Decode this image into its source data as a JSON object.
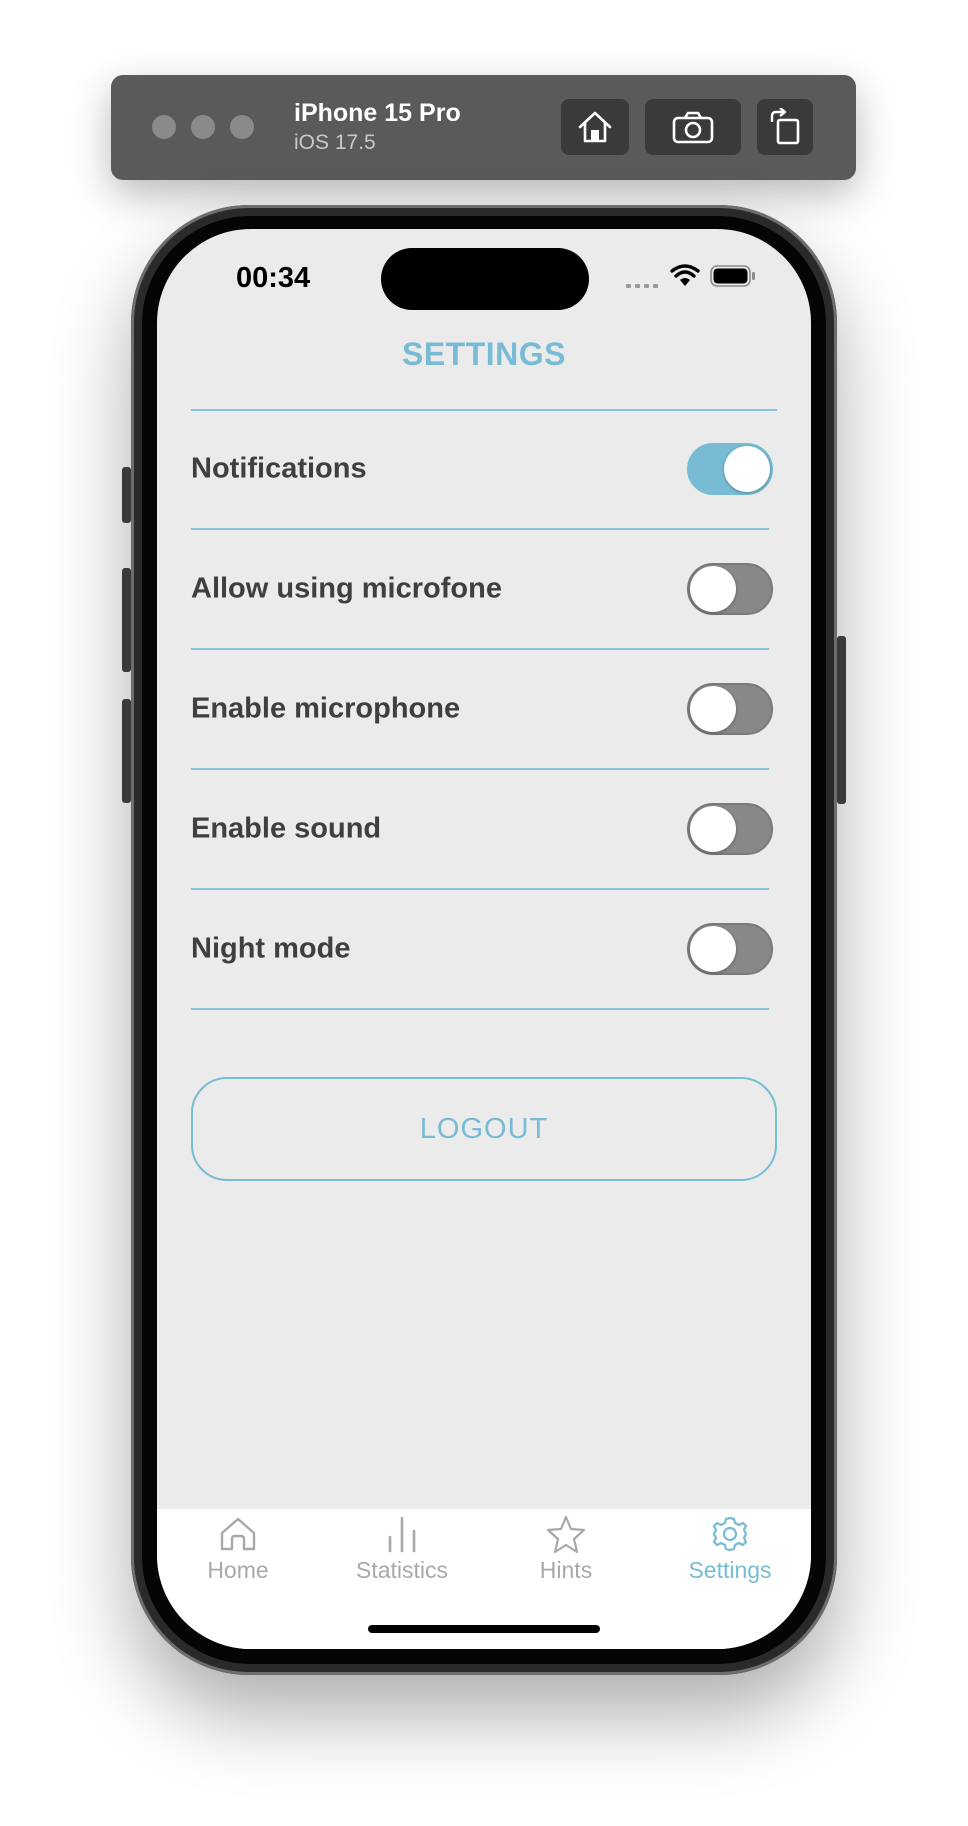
{
  "simulator": {
    "device_name": "iPhone 15 Pro",
    "os_version": "iOS 17.5",
    "buttons": [
      "home-icon",
      "screenshot-icon",
      "rotate-icon"
    ]
  },
  "status_bar": {
    "time": "00:34"
  },
  "screen": {
    "title": "SETTINGS",
    "settings": [
      {
        "label": "Notifications",
        "enabled": true
      },
      {
        "label": "Allow using microfone",
        "enabled": false
      },
      {
        "label": "Enable microphone",
        "enabled": false
      },
      {
        "label": "Enable sound",
        "enabled": false
      },
      {
        "label": "Night mode",
        "enabled": false
      }
    ],
    "logout_label": "LOGOUT"
  },
  "tab_bar": {
    "tabs": [
      {
        "label": "Home",
        "icon": "home-icon",
        "active": false
      },
      {
        "label": "Statistics",
        "icon": "bar-chart-icon",
        "active": false
      },
      {
        "label": "Hints",
        "icon": "star-icon",
        "active": false
      },
      {
        "label": "Settings",
        "icon": "gear-icon",
        "active": true
      }
    ]
  },
  "colors": {
    "accent": "#77bcd4",
    "screen_background": "#ebebeb",
    "label_text": "#3f3f3f",
    "toggle_off": "#888888",
    "tab_inactive": "#a9a9a9"
  }
}
